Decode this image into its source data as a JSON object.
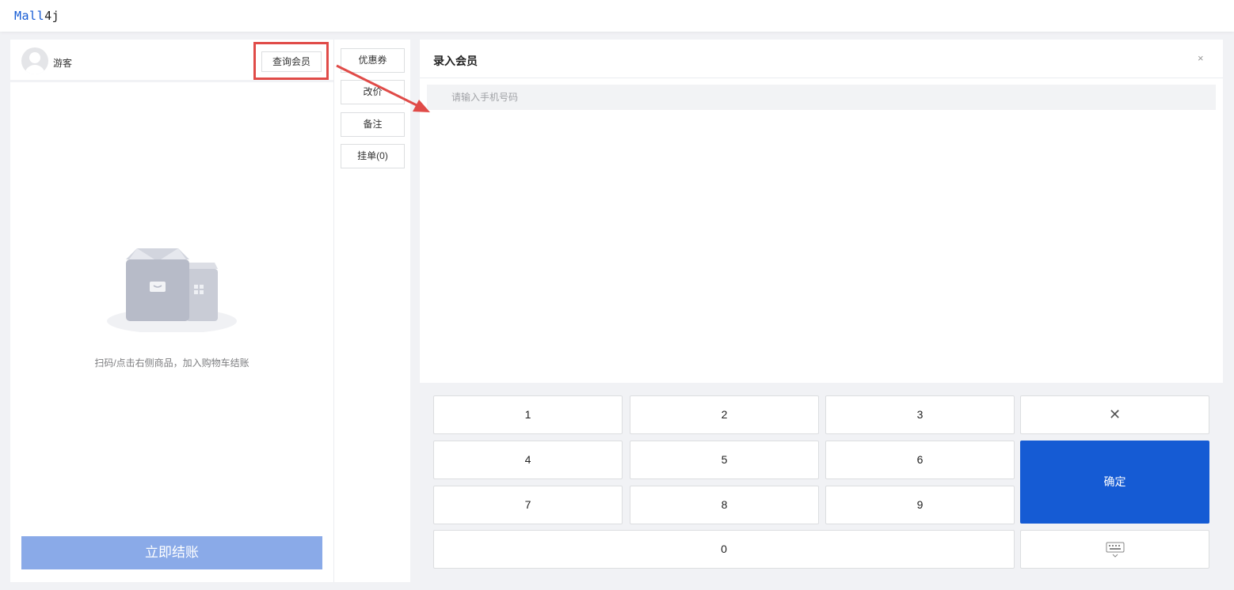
{
  "app": {
    "logo_part1": "Mall",
    "logo_part2": "4j"
  },
  "member": {
    "guest_label": "游客",
    "query_button": "查询会员"
  },
  "cart": {
    "empty_text": "扫码/点击右侧商品，加入购物车结账",
    "checkout_button": "立即结账"
  },
  "actions": {
    "coupon": "优惠券",
    "change_price": "改价",
    "remark": "备注",
    "hold_order": "挂单(0)"
  },
  "dialog": {
    "title": "录入会员",
    "close_glyph": "×",
    "phone_placeholder": "请输入手机号码",
    "phone_value": ""
  },
  "keypad": {
    "k1": "1",
    "k2": "2",
    "k3": "3",
    "k4": "4",
    "k5": "5",
    "k6": "6",
    "k7": "7",
    "k8": "8",
    "k9": "9",
    "k0": "0",
    "backspace_glyph": "✕",
    "confirm": "确定",
    "keyboard_icon": "keyboard-icon"
  },
  "colors": {
    "brand": "#155bd4",
    "checkout_disabled": "#8aaae8",
    "annotation": "#e04b48"
  }
}
